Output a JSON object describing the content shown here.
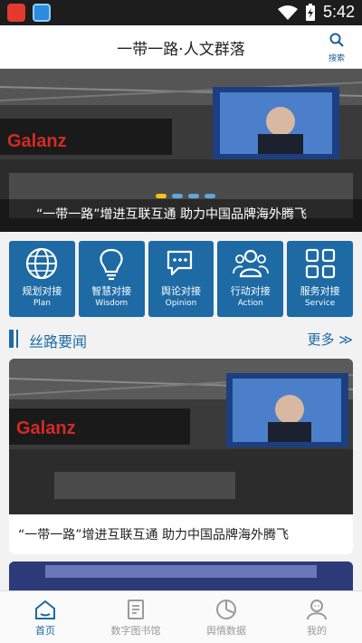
{
  "status_bar": {
    "time": "5:42"
  },
  "header": {
    "title": "一带一路·人文群落",
    "search_label": "搜索"
  },
  "banner": {
    "caption": "“一带一路”增进互联互通 助力中国品牌海外腾飞",
    "brand_sign": "Galanz"
  },
  "tiles": [
    {
      "zh": "规划对接",
      "en": "Plan",
      "icon": "globe-icon"
    },
    {
      "zh": "智慧对接",
      "en": "Wisdom",
      "icon": "lightbulb-icon"
    },
    {
      "zh": "舆论对接",
      "en": "Opinion",
      "icon": "chat-bubbles-icon"
    },
    {
      "zh": "行动对接",
      "en": "Action",
      "icon": "people-icon"
    },
    {
      "zh": "服务对接",
      "en": "Service",
      "icon": "grid-icon"
    }
  ],
  "section": {
    "title": "丝路要闻",
    "more_label": "更多 ≫"
  },
  "news": [
    {
      "title": "“一带一路”增进互联互通 助力中国品牌海外腾飞"
    }
  ],
  "tabs": [
    {
      "label": "首页",
      "icon": "home-icon"
    },
    {
      "label": "数字图书馆",
      "icon": "book-icon"
    },
    {
      "label": "舆情数据",
      "icon": "pie-chart-icon"
    },
    {
      "label": "我的",
      "icon": "user-icon"
    }
  ],
  "colors": {
    "primary": "#1d6aa5",
    "accent_dot": "#f2c21b"
  }
}
